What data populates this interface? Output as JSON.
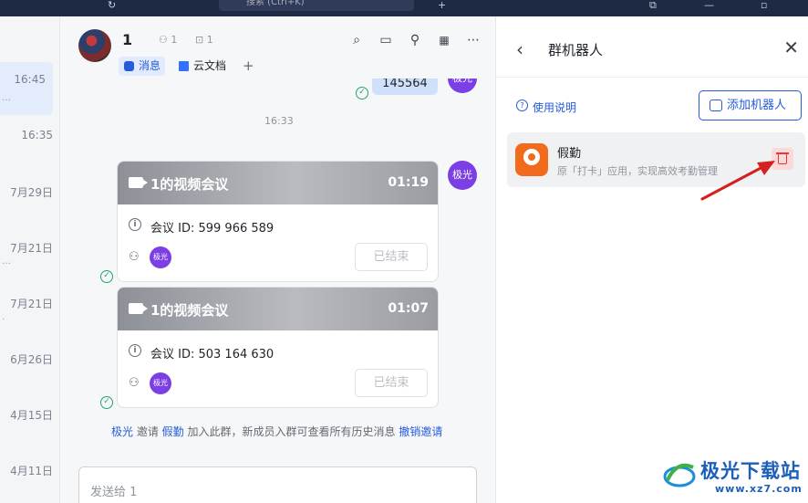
{
  "topbar": {
    "search_text": "搜索 (Ctrl+K)"
  },
  "conversation_list": [
    {
      "time": "16:45",
      "active": true,
      "dots": "…"
    },
    {
      "time": "16:35",
      "active": false,
      "dots": ""
    },
    {
      "time": "7月29日",
      "active": false,
      "dots": ""
    },
    {
      "time": "7月21日",
      "active": false,
      "dots": "…"
    },
    {
      "time": "7月21日",
      "active": false,
      "dots": "."
    },
    {
      "time": "6月26日",
      "active": false,
      "dots": ""
    },
    {
      "time": "4月15日",
      "active": false,
      "dots": ""
    },
    {
      "time": "4月11日",
      "active": false,
      "dots": ""
    }
  ],
  "chat": {
    "title": "1",
    "members": "1",
    "bots": "1",
    "tabs": [
      {
        "label": "消息",
        "active": true
      },
      {
        "label": "云文档",
        "active": false
      }
    ],
    "add_tab": "+",
    "top_bubble": "145564",
    "sender_name": "极光",
    "timestamp": "16:33",
    "cards": [
      {
        "title": "1的视频会议",
        "duration": "01:19",
        "meeting_id": "会议 ID: 599 966 589",
        "status": "已结束",
        "participant": "极光"
      },
      {
        "title": "1的视频会议",
        "duration": "01:07",
        "meeting_id": "会议 ID: 503 164 630",
        "status": "已结束",
        "participant": "极光"
      }
    ],
    "system_message": {
      "actor": "极光",
      "verb": " 邀请 ",
      "target": "假勤",
      "rest": " 加入此群，新成员入群可查看所有历史消息 ",
      "revoke": "撤销邀请"
    },
    "input_placeholder": "发送给 1"
  },
  "bot_panel": {
    "title": "群机器人",
    "help_link": "使用说明",
    "add_button": "添加机器人",
    "bots": [
      {
        "name": "假勤",
        "description": "原「打卡」应用，实现高效考勤管理"
      }
    ]
  },
  "watermark": {
    "text": "极光下载站",
    "url": "www.xz7.com"
  },
  "colors": {
    "accent": "#245bdb",
    "avatar_purple": "#7b3fe4",
    "danger": "#e23a3a",
    "bot_orange": "#f26b1d",
    "arrow_red": "#d61f1f"
  }
}
